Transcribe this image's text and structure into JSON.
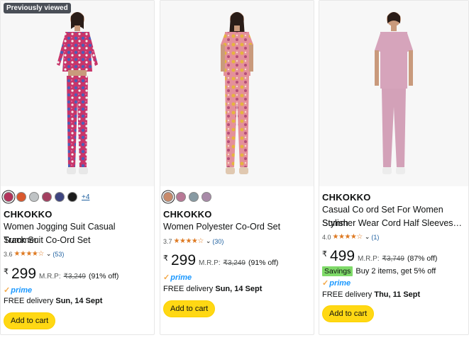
{
  "colors": {
    "prime_blue": "#1a98ff",
    "star_orange": "#de7921",
    "cart_yellow": "#ffd814",
    "savings_green": "#7fda69",
    "link_blue": "#2162a1"
  },
  "products": [
    {
      "badge": "Previously viewed",
      "image_icon": "model-print-tracksuit",
      "swatches": [
        "#b3325a",
        "#d9572d",
        "#bfc3c5",
        "#a34060",
        "#3e4580",
        "#1b1b1b"
      ],
      "more_colors": "+4",
      "brand": "CHKOKKO",
      "title_line1": "Women Jogging Suit Casual Summer",
      "title_line2": "Track Suit Co-Ord Set",
      "rating_value": "3.6",
      "stars": "★★★★☆",
      "rating_count": "(53)",
      "currency": "₹",
      "price": "299",
      "mrp_label": "M.R.P:",
      "mrp": "₹3,249",
      "discount": "(91% off)",
      "prime_label": "prime",
      "delivery_prefix": "FREE delivery",
      "delivery_date": "Sun, 14 Sept",
      "cart_label": "Add to cart"
    },
    {
      "image_icon": "model-floral-coord",
      "swatches": [
        "#c98a6a",
        "#b87896",
        "#879aa3",
        "#a88aa8"
      ],
      "brand": "CHKOKKO",
      "title_line1": "Women Polyester Co-Ord Set",
      "rating_value": "3.7",
      "stars": "★★★★☆",
      "rating_count": "(30)",
      "currency": "₹",
      "price": "299",
      "mrp_label": "M.R.P:",
      "mrp": "₹3,249",
      "discount": "(91% off)",
      "prime_label": "prime",
      "delivery_prefix": "FREE delivery",
      "delivery_date": "Sun, 14 Sept",
      "cart_label": "Add to cart"
    },
    {
      "image_icon": "model-pink-coord",
      "brand": "CHKOKKO",
      "title_line1": "Casual Co ord Set For Women Stylish",
      "title_line2": "Summer Wear Cord Half Sleeves…",
      "rating_value": "4.0",
      "stars": "★★★★☆",
      "rating_count": "(1)",
      "currency": "₹",
      "price": "499",
      "mrp_label": "M.R.P:",
      "mrp": "₹3,749",
      "discount": "(87% off)",
      "savings_badge": "Savings",
      "savings_text": "Buy 2 items, get 5% off",
      "prime_label": "prime",
      "delivery_prefix": "FREE delivery",
      "delivery_date": "Thu, 11 Sept",
      "cart_label": "Add to cart"
    }
  ]
}
